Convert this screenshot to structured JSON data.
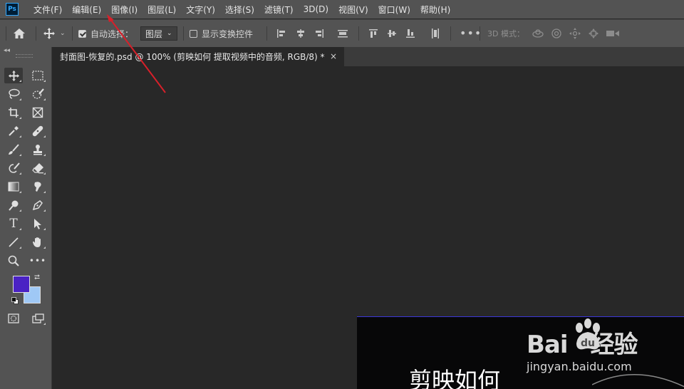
{
  "app": {
    "logo_text": "Ps"
  },
  "menubar": {
    "items": [
      {
        "label": "文件(F)"
      },
      {
        "label": "编辑(E)"
      },
      {
        "label": "图像(I)"
      },
      {
        "label": "图层(L)"
      },
      {
        "label": "文字(Y)"
      },
      {
        "label": "选择(S)"
      },
      {
        "label": "滤镜(T)"
      },
      {
        "label": "3D(D)"
      },
      {
        "label": "视图(V)"
      },
      {
        "label": "窗口(W)"
      },
      {
        "label": "帮助(H)"
      }
    ]
  },
  "options": {
    "auto_select_label": "自动选择：",
    "auto_select_checked": true,
    "target_value": "图层",
    "show_transform_label": "显示变换控件",
    "show_transform_checked": false,
    "mode_3d_label": "3D 模式："
  },
  "document": {
    "tab_title": "封面图-恢复的.psd @ 100% (剪映如何 提取视频中的音频, RGB/8) *",
    "close_symbol": "×",
    "canvas_text": "剪映如何"
  },
  "colors": {
    "foreground": "#4a22c4",
    "background": "#9fc8f5",
    "annotation_arrow": "#d8202a"
  },
  "watermark": {
    "brand_prefix": "Bai",
    "brand_suffix": "经验",
    "url": "jingyan.baidu.com"
  }
}
